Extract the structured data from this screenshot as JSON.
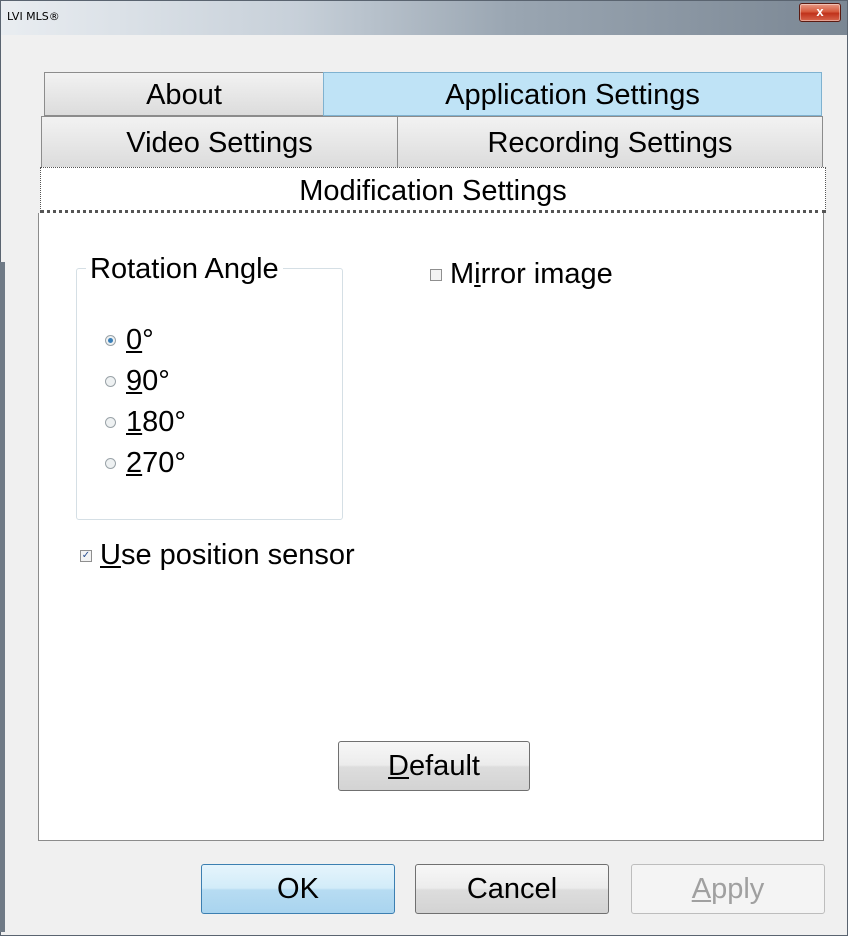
{
  "window": {
    "title": "LVI MLS®",
    "close_glyph": "x"
  },
  "tabs": {
    "row1": [
      "About",
      "Application Settings"
    ],
    "row2": [
      "Video Settings",
      "Recording Settings"
    ],
    "row3": [
      "Modification Settings"
    ]
  },
  "rotation": {
    "group_label": "Rotation Angle",
    "options": [
      {
        "label": "0°",
        "mnemonic": "0",
        "rest": "°",
        "checked": true
      },
      {
        "label": "90°",
        "mnemonic": "9",
        "rest": "0°",
        "checked": false
      },
      {
        "label": "180°",
        "mnemonic": "1",
        "rest": "80°",
        "checked": false
      },
      {
        "label": "270°",
        "mnemonic": "2",
        "rest": "70°",
        "checked": false
      }
    ]
  },
  "mirror": {
    "label_pre": "M",
    "mnemonic": "i",
    "label_post": "rror image",
    "checked": false
  },
  "position_sensor": {
    "mnemonic": "U",
    "label_post": "se position sensor",
    "checked": true
  },
  "buttons": {
    "default": {
      "mnemonic": "D",
      "rest": "efault"
    },
    "ok": "OK",
    "cancel": "Cancel",
    "apply": {
      "mnemonic": "A",
      "rest": "pply",
      "enabled": false
    }
  }
}
